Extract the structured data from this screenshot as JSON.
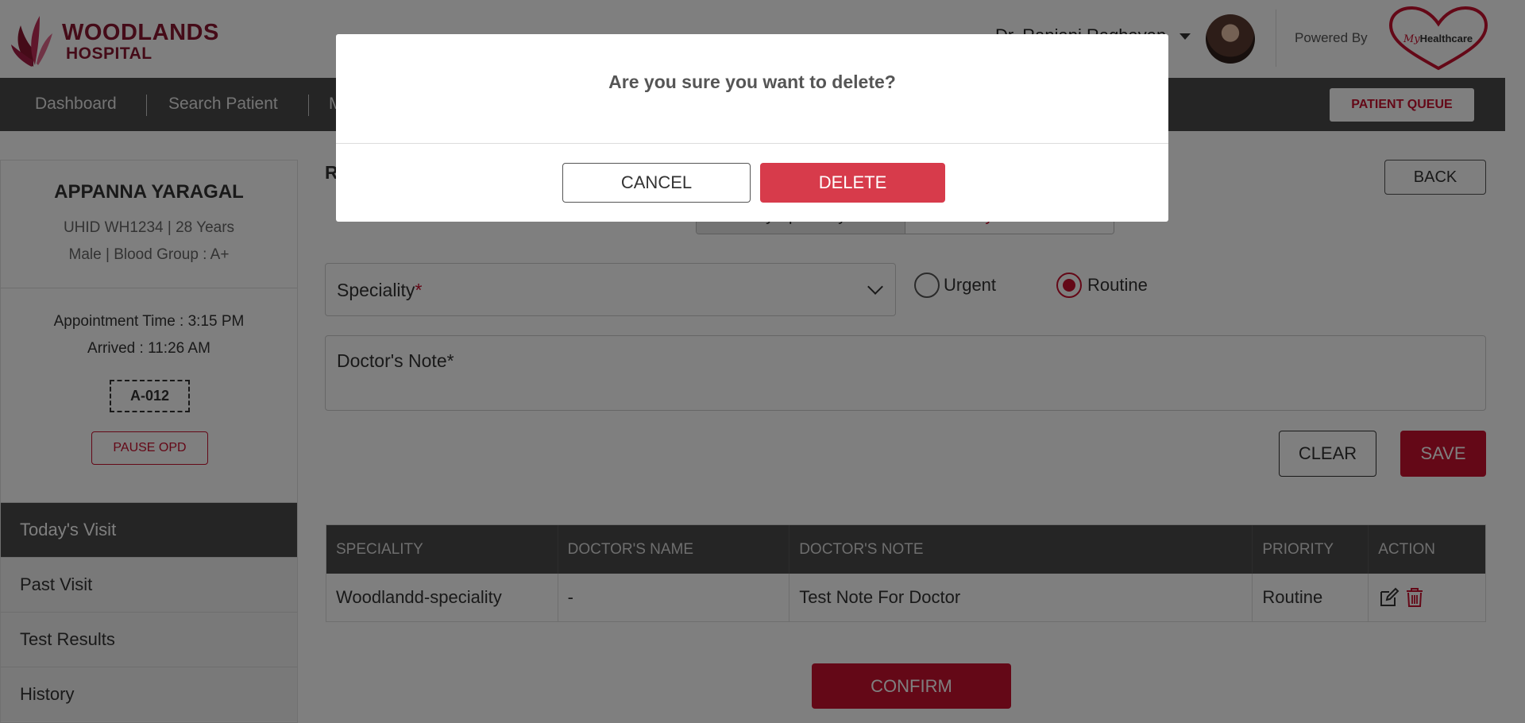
{
  "header": {
    "logo_line1": "WOODLANDS",
    "logo_line2": "HOSPITAL",
    "doctor_name": "Dr. Ranjani Raghavan",
    "powered_by": "Powered By",
    "partner_logo_prefix": "My",
    "partner_logo_suffix": "Healthcare"
  },
  "nav": {
    "items": [
      "Dashboard",
      "Search Patient",
      "M"
    ],
    "queue_button": "PATIENT QUEUE"
  },
  "patient": {
    "name": "APPANNA YARAGAL",
    "line1": "UHID WH1234 | 28 Years",
    "line2": "Male | Blood Group : A+",
    "appointment": "Appointment Time : 3:15 PM",
    "arrived": "Arrived : 11:26 AM",
    "token": "A-012",
    "pause_button": "PAUSE OPD"
  },
  "side_menu": [
    "Today's Visit",
    "Past Visit",
    "Test Results",
    "History"
  ],
  "main": {
    "title_partial": "R",
    "back_button": "BACK",
    "toggle": {
      "left": "By Speciality",
      "right": "By Doctor"
    },
    "speciality_label": "Speciality",
    "required_mark": "*",
    "priority_options": [
      "Urgent",
      "Routine"
    ],
    "selected_priority": "Routine",
    "note_placeholder": "Doctor's Note*",
    "clear_button": "CLEAR",
    "save_button": "SAVE",
    "confirm_button": "CONFIRM"
  },
  "table": {
    "headers": [
      "SPECIALITY",
      "DOCTOR'S NAME",
      "DOCTOR'S NOTE",
      "PRIORITY",
      "ACTION"
    ],
    "rows": [
      [
        "Woodlandd-speciality",
        "-",
        "Test Note For Doctor",
        "Routine"
      ]
    ]
  },
  "modal": {
    "question": "Are you sure you want to delete?",
    "cancel": "CANCEL",
    "delete": "DELETE"
  },
  "colors": {
    "brand": "#8a1731",
    "accent": "#c8102e",
    "nav_bg": "#4a4a4a"
  }
}
